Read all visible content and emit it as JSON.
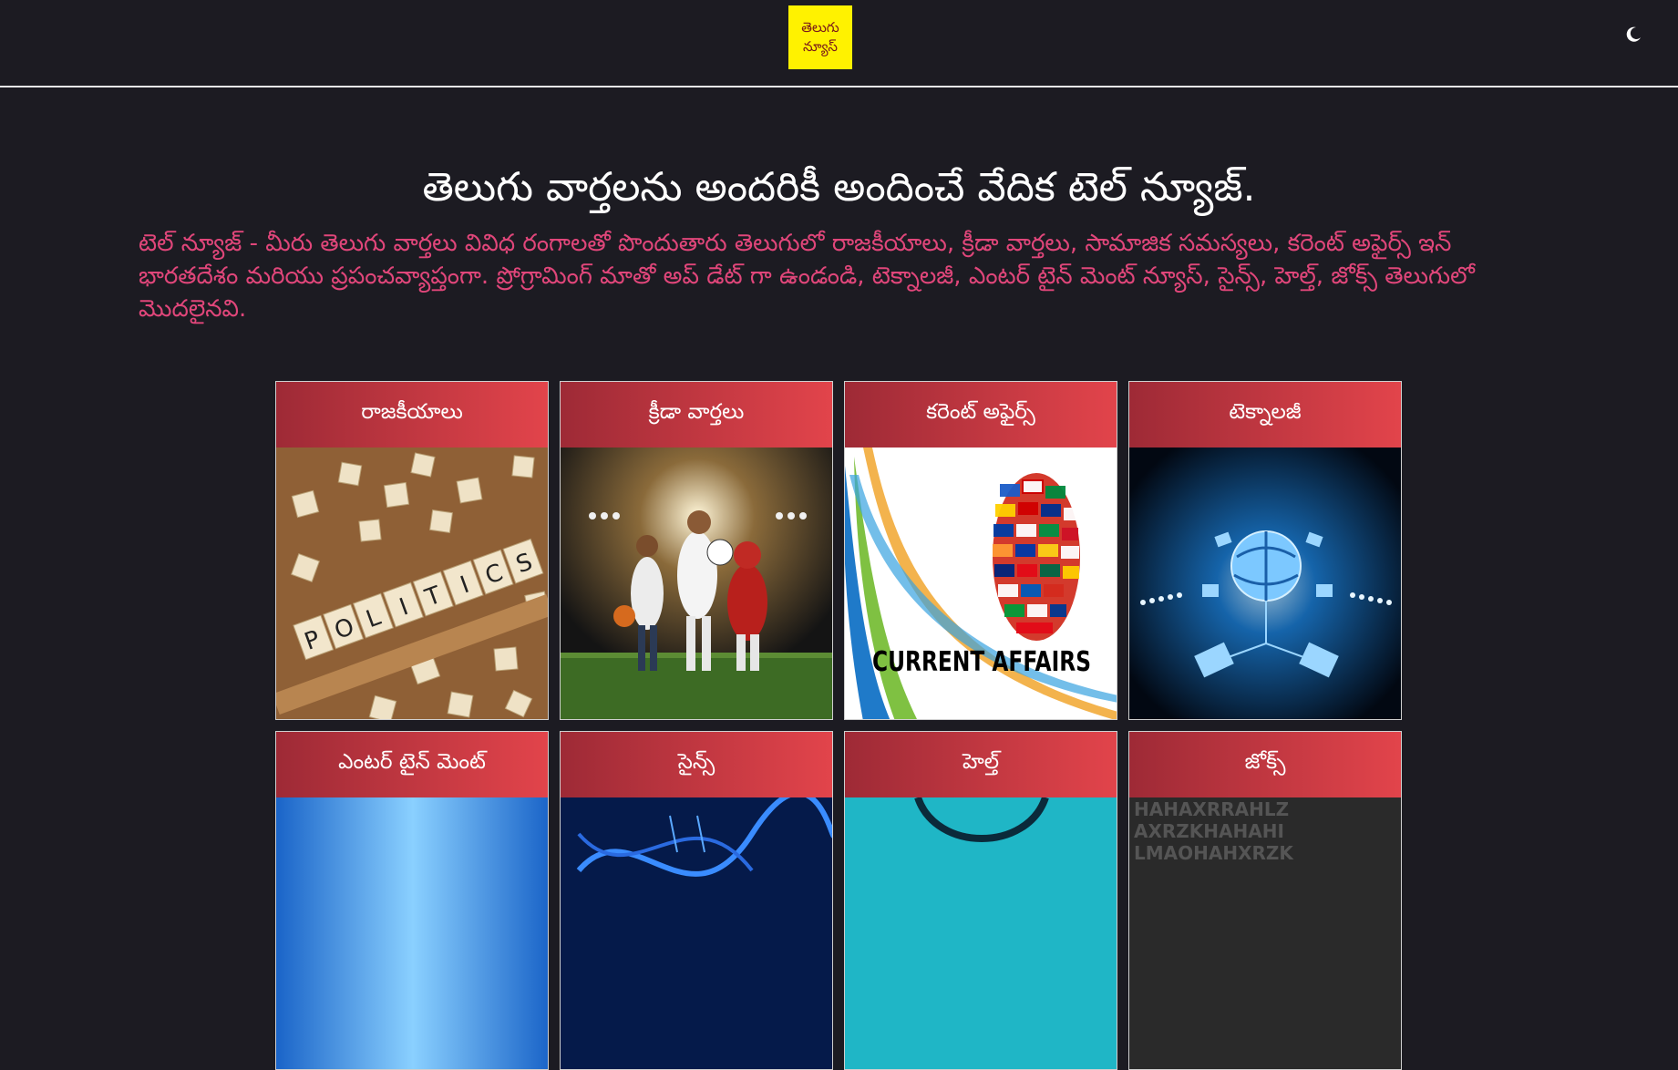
{
  "header": {
    "logo_line1": "తెలుగు",
    "logo_line2": "న్యూస్",
    "theme_icon": "moon-icon"
  },
  "hero": {
    "title": "తెలుగు వార్తలను అందరికీ అందించే వేదిక టెల్ న్యూజ్.",
    "description": "టెల్ న్యూజ్ - మీరు తెలుగు వార్తలు వివిధ రంగాలతో పొందుతారు తెలుగులో రాజకీయాలు, క్రీడా వార్తలు, సామాజిక సమస్యలు, కరెంట్ అఫైర్స్ ఇన్ భారతదేశం మరియు ప్రపంచవ్యాప్తంగా. ప్రోగ్రామింగ్ మాతో అప్ డేట్ గా ఉండండి, టెక్నాలజీ, ఎంటర్ టైన్ మెంట్ న్యూస్, సైన్స్, హెల్త్, జోక్స్ తెలుగులో మొదలైనవి."
  },
  "categories": [
    {
      "label": "రాజకీయాలు",
      "image": "politics-scrabble-image"
    },
    {
      "label": "క్రీడా వార్తలు",
      "image": "sports-players-image"
    },
    {
      "label": "కరెంట్ అఫైర్స్",
      "image": "current-affairs-globe-image",
      "image_text": "CURRENT AFFAIRS"
    },
    {
      "label": "టెక్నాలజీ",
      "image": "technology-network-image"
    },
    {
      "label": "ఎంటర్ టైన్ మెంట్",
      "image": "entertainment-image"
    },
    {
      "label": "సైన్స్",
      "image": "science-dna-image"
    },
    {
      "label": "హెల్త్",
      "image": "health-stethoscope-image"
    },
    {
      "label": "జోక్స్",
      "image": "jokes-letters-image"
    }
  ],
  "colors": {
    "background": "#1c1b22",
    "accent_text": "#e0467a",
    "card_header_start": "#9e2a36",
    "card_header_end": "#e2444b",
    "logo_bg": "#fff200"
  }
}
